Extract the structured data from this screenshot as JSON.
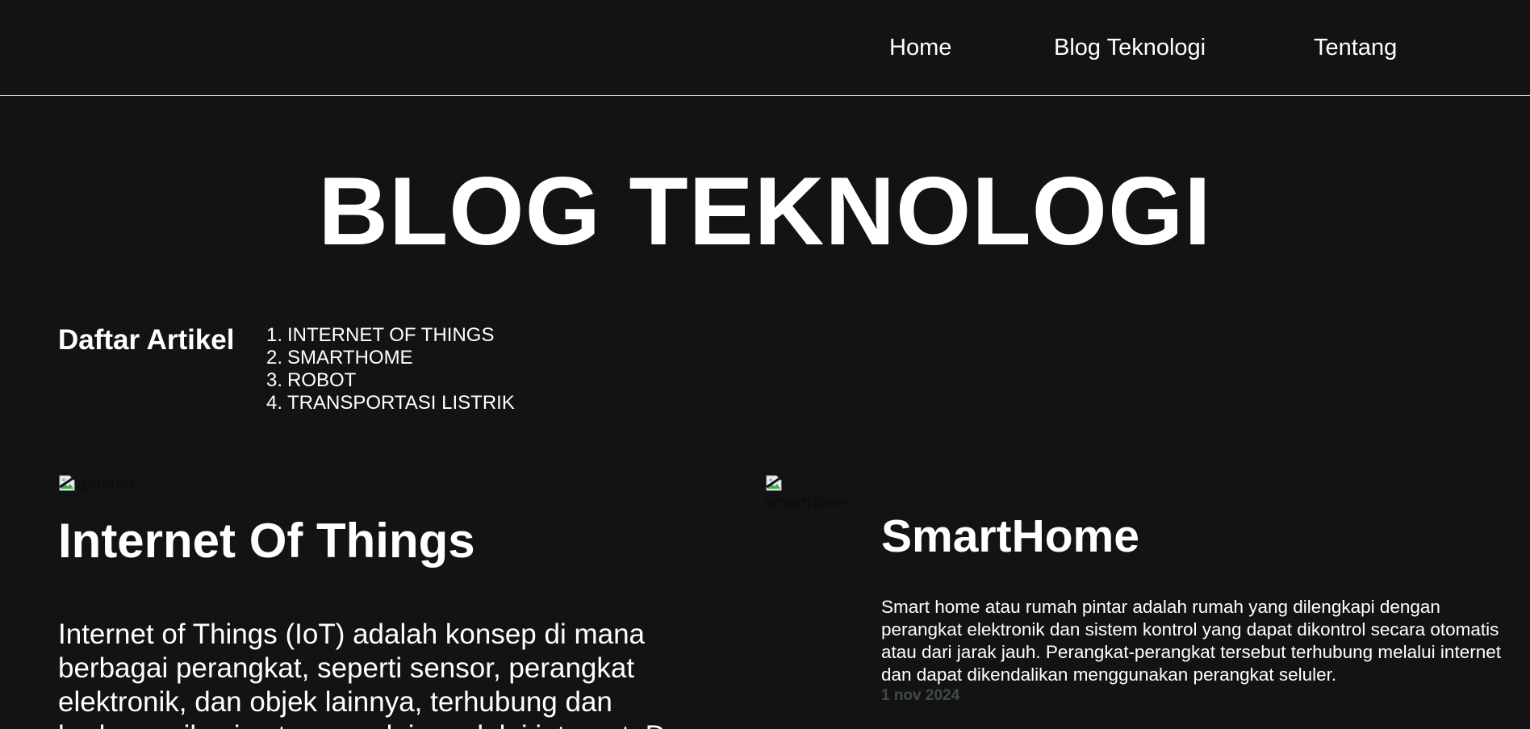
{
  "nav": {
    "items": [
      {
        "label": "Home"
      },
      {
        "label": "Blog Teknologi"
      },
      {
        "label": "Tentang"
      }
    ]
  },
  "hero": {
    "title": "BLOG TEKNOLOGI"
  },
  "toc": {
    "heading": "Daftar Artikel",
    "items": [
      {
        "number": "1.",
        "label": "INTERNET OF THINGS"
      },
      {
        "number": "2.",
        "label": "SMARTHOME"
      },
      {
        "number": "3.",
        "label": "ROBOT"
      },
      {
        "number": "4.",
        "label": "TRANSPORTASI LISTRIK"
      }
    ]
  },
  "articles": [
    {
      "image_alt": "gambar",
      "title": "Internet Of Things",
      "body": "Internet of Things (IoT) adalah konsep di mana berbagai perangkat, seperti sensor, perangkat elektronik, dan objek lainnya, terhubung dan berkomunikasi satu sama lain melalui internet. D"
    },
    {
      "image_alt": "smarthome",
      "title": "SmartHome",
      "body": "Smart home atau rumah pintar adalah rumah yang dilengkapi dengan perangkat elektronik dan sistem kontrol yang dapat dikontrol secara otomatis atau dari jarak jauh. Perangkat-perangkat tersebut terhubung melalui internet dan dapat dikendalikan menggunakan perangkat seluler.",
      "date": "1 nov 2024"
    }
  ],
  "icons": {
    "broken_image": "broken-image-icon"
  },
  "colors": {
    "background": "#131313",
    "text": "#ffffff",
    "date": "#3f4a4a",
    "nav_border": "#d8d8d8"
  }
}
